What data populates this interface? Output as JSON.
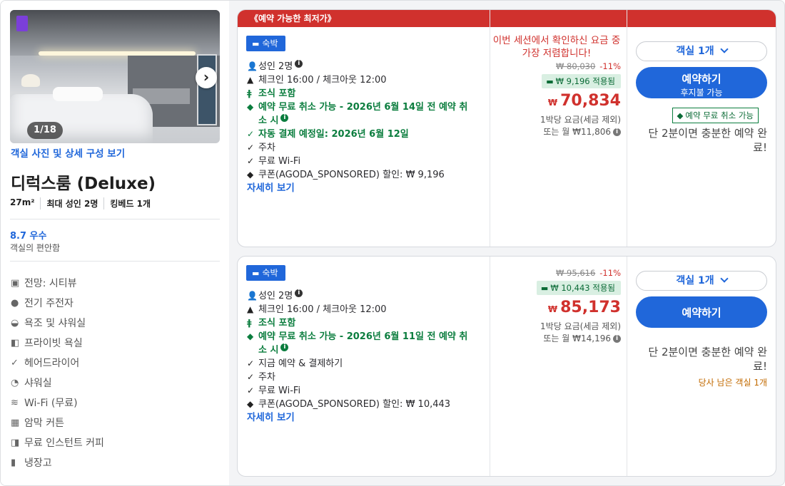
{
  "room": {
    "photo_counter": "1/18",
    "photos_link": "객실 사진 및 상세 구성 보기",
    "name": "디럭스룸 (Deluxe)",
    "specs": [
      "27m²",
      "최대 성인 2명",
      "킹베드 1개"
    ],
    "score": "8.7 우수",
    "score_sub": "객실의 편안함",
    "features": [
      {
        "icon": "view-icon",
        "label": "전망: 시티뷰"
      },
      {
        "icon": "plug-icon",
        "label": "전기 주전자"
      },
      {
        "icon": "bathtub-icon",
        "label": "욕조 및 샤워실"
      },
      {
        "icon": "bath-icon",
        "label": "프라이빗 욕실"
      },
      {
        "icon": "hairdryer-icon",
        "label": "헤어드라이어"
      },
      {
        "icon": "shower-icon",
        "label": "샤워실"
      },
      {
        "icon": "wifi-icon",
        "label": "Wi-Fi (무료)"
      },
      {
        "icon": "curtain-icon",
        "label": "암막 커튼"
      },
      {
        "icon": "coffee-icon",
        "label": "무료 인스턴트 커피"
      },
      {
        "icon": "fridge-icon",
        "label": "냉장고"
      }
    ]
  },
  "offers": [
    {
      "ribbon": "《예약 가능한 최저가》",
      "type_label": "숙박",
      "guests": "성인 2명",
      "checkin": "체크인 16:00 / 체크아웃 12:00",
      "breakfast": "조식 포함",
      "free_cancel_line1": "예약 무료 취소 가능 - 2026년 6월 14일 전 예약 취",
      "free_cancel_line2": "소 시",
      "payment": "자동 결제 예정일: 2026년 6월 12일",
      "parking": "주차",
      "wifi": "무료 Wi-Fi",
      "coupon": "쿠폰(AGODA_SPONSORED) 할인: ₩ 9,196",
      "more": "자세히 보기",
      "lowest_msg": "이번 세션에서 확인하신 요금 중 가장 저렴합니다!",
      "original_price": "₩ 80,030",
      "discount_pct": "-11%",
      "coupon_chip": "₩ 9,196 적용됨",
      "currency": "₩",
      "price": "70,834",
      "per_night": "1박당 요금(세금 제외)",
      "monthly": "또는 월 ₩11,806",
      "room_select": "객실 1개",
      "book_label": "예약하기",
      "book_sub": "후지불 가능",
      "free_cancel_badge": "예약 무료 취소 가능",
      "quick_note": "단 2분이면 충분한 예약 완료!"
    },
    {
      "type_label": "숙박",
      "guests": "성인 2명",
      "checkin": "체크인 16:00 / 체크아웃 12:00",
      "breakfast": "조식 포함",
      "free_cancel_line1": "예약 무료 취소 가능 - 2026년 6월 11일 전 예약 취",
      "free_cancel_line2": "소 시",
      "payment": "지금 예약 & 결제하기",
      "parking": "주차",
      "wifi": "무료 Wi-Fi",
      "coupon": "쿠폰(AGODA_SPONSORED) 할인: ₩ 10,443",
      "more": "자세히 보기",
      "original_price": "₩ 95,616",
      "discount_pct": "-11%",
      "coupon_chip": "₩ 10,443 적용됨",
      "currency": "₩",
      "price": "85,173",
      "per_night": "1박당 요금(세금 제외)",
      "monthly": "또는 월 ₩14,196",
      "room_select": "객실 1개",
      "book_label": "예약하기",
      "quick_note": "단 2분이면 충분한 예약 완료!",
      "rooms_left": "당사 남은 객실 1개"
    }
  ],
  "colors": {
    "accent": "#2067da",
    "price_red": "#d0312d",
    "green": "#0b7d3e"
  }
}
